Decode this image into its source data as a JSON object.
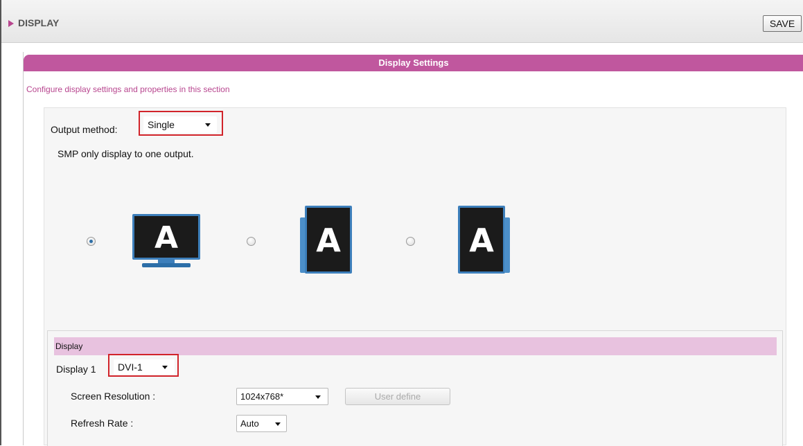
{
  "header": {
    "title": "DISPLAY",
    "save_label": "SAVE"
  },
  "panel": {
    "title": "Display Settings",
    "description": "Configure display settings and properties in this section"
  },
  "output": {
    "label": "Output method:",
    "selected": "Single",
    "description": "SMP only display to one output."
  },
  "orientations": [
    {
      "name": "landscape",
      "selected": true,
      "letter": "A"
    },
    {
      "name": "portrait-left",
      "selected": false,
      "letter": "A"
    },
    {
      "name": "portrait-right",
      "selected": false,
      "letter": "A"
    }
  ],
  "display": {
    "section_title": "Display",
    "display1_label": "Display 1",
    "display1_selected": "DVI-1",
    "resolution_label": "Screen Resolution :",
    "resolution_selected": "1024x768*",
    "user_define_label": "User define",
    "refresh_label": "Refresh Rate :",
    "refresh_selected": "Auto"
  },
  "colors": {
    "accent": "#c0579e",
    "section_bg": "#e8c2df",
    "highlight": "#d1232a",
    "monitor_frame": "#3d7fbb"
  }
}
